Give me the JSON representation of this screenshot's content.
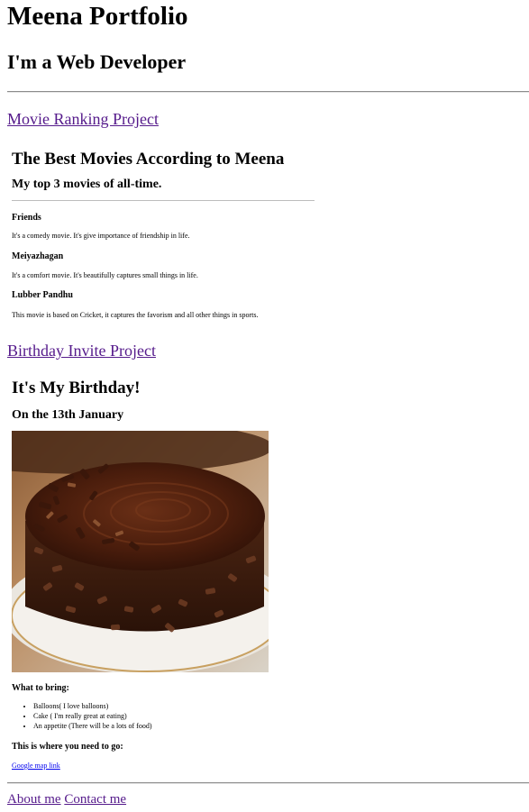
{
  "site": {
    "title": "Meena Portfolio",
    "subtitle": "I'm a Web Developer"
  },
  "projects": {
    "movie_link": "Movie Ranking Project",
    "birthday_link": "Birthday Invite Project"
  },
  "movie": {
    "heading": "The Best Movies According to Meena",
    "subheading": "My top 3 movies of all-time.",
    "items": [
      {
        "title": "Friends",
        "desc": "It's a comedy movie. It's give importance of friendship in life."
      },
      {
        "title": "Meiyazhagan",
        "desc": "It's a comfort movie. It's beautifully captures small things in life."
      },
      {
        "title": "Lubber Pandhu",
        "desc": "This movie is based on Cricket, it captures the favorism and all other things in sports."
      }
    ]
  },
  "birthday": {
    "heading": "It's My Birthday!",
    "date": "On the 13th January",
    "bring_title": "What to bring:",
    "bring_items": [
      "Balloons( I love balloons)",
      "Cake ( I'm really great at eating)",
      "An appetite (There will be a lots of food)"
    ],
    "where_title": "This is where you need to go:",
    "map_link": "Google map link"
  },
  "footer": {
    "about": "About me",
    "contact": "Contact me"
  }
}
